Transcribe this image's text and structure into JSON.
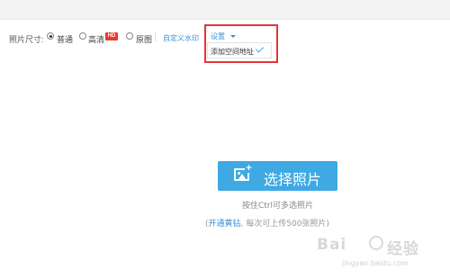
{
  "toolbar": {
    "size_label": "照片尺寸:",
    "options": [
      {
        "label": "普通",
        "selected": true
      },
      {
        "label": "高清",
        "selected": false,
        "badge": "HD"
      },
      {
        "label": "原图",
        "selected": false
      }
    ],
    "watermark_link": "自定义水印",
    "settings_label": "设置"
  },
  "dropdown": {
    "item_label": "添加空间地址",
    "item_checked": true
  },
  "upload": {
    "button_label": "选择照片",
    "hint_primary": "按住Ctrl可多选照片",
    "hint_secondary_open": "(",
    "hint_secondary_link": "开通黄钻",
    "hint_secondary_rest": ", 每次可上传500张照片)"
  },
  "watermark": {
    "brand": "Bai",
    "brand_cn": "经验",
    "url": "jingyan.baidu.com"
  },
  "colors": {
    "accent_blue": "#3fa9e4",
    "link_blue": "#3b8fd6",
    "highlight_red": "#e4343a",
    "hd_red": "#e8382f"
  }
}
